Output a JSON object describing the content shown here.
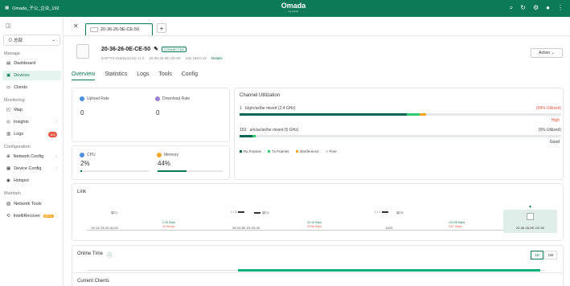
{
  "topbar": {
    "site_label": "Omada_子公_企业_192",
    "logo": "Omada",
    "logo_sub": "by tp-link",
    "icons": [
      "search-icon",
      "refresh-icon",
      "settings-icon",
      "user-icon",
      "more-icon"
    ],
    "color": "#0d7a57"
  },
  "sidebar": {
    "site_select": "总部",
    "sections": [
      {
        "title": "Manage",
        "items": [
          {
            "label": "Dashboard",
            "icon": "dashboard-icon"
          },
          {
            "label": "Devices",
            "icon": "devices-icon",
            "active": true
          },
          {
            "label": "Clients",
            "icon": "clients-icon"
          }
        ]
      },
      {
        "title": "Monitoring",
        "items": [
          {
            "label": "Map",
            "icon": "map-icon"
          },
          {
            "label": "Insights",
            "icon": "insights-icon",
            "arrow": true
          },
          {
            "label": "Logs",
            "icon": "logs-icon",
            "count": "404"
          }
        ]
      },
      {
        "title": "Configuration",
        "items": [
          {
            "label": "Network Config",
            "icon": "network-config-icon",
            "arrow": true
          },
          {
            "label": "Device Config",
            "icon": "device-config-icon",
            "arrow": true
          },
          {
            "label": "Hotspot",
            "icon": "hotspot-icon"
          }
        ]
      },
      {
        "title": "Maintain",
        "items": [
          {
            "label": "Network Tools",
            "icon": "network-tools-icon"
          },
          {
            "label": "IntelliRecover",
            "icon": "intellirecover-icon",
            "badge": "BETA"
          }
        ]
      }
    ]
  },
  "device_tab": {
    "label": "20-36-26-0E-CE-50"
  },
  "device": {
    "name": "20-36-26-0E-CE-50",
    "status": "CONNECTED",
    "model": "EAP772-Outdoor(US) v1.0",
    "mac": "20-36-26-0E-CE-50",
    "ip": "192.168.0.12",
    "details_link": "Details",
    "action_label": "Action"
  },
  "subtabs": [
    "Overview",
    "Statistics",
    "Logs",
    "Tools",
    "Config"
  ],
  "stats": {
    "upload_label": "Upload Rate",
    "upload_value": "0",
    "download_label": "Download Rate",
    "download_value": "0",
    "cpu_label": "CPU",
    "cpu_value": "2%",
    "cpu_fraction": 0.02,
    "memory_label": "Memory",
    "memory_value": "44%",
    "memory_fraction": 0.44
  },
  "channel": {
    "title": "Channel Utilization",
    "rows": [
      {
        "num": "1",
        "band": "b/g/n/ax/be mixed  (2.4 GHz)",
        "util": "(58% Utilized)",
        "level": "High",
        "level_color": "#e5533d",
        "rx": 0.52,
        "tx": 0.04,
        "interf": 0.02
      },
      {
        "num": "153",
        "band": "a/n/ac/ax/be mixed  (5 GHz)",
        "util": "(5% Utilized)",
        "level": "Good",
        "level_color": "#333333",
        "rx": 0.04,
        "tx": 0.01,
        "interf": 0.0
      }
    ],
    "legend": [
      {
        "label": "Rx Frames",
        "color": "#0e6655"
      },
      {
        "label": "Tx Frames",
        "color": "#2ecc71"
      },
      {
        "label": "Interference",
        "color": "#f5a623"
      },
      {
        "label": "Free",
        "color": "#d9dde2"
      }
    ]
  },
  "link": {
    "title": "Link",
    "nodes": [
      {
        "name": "00-14-78-00-00-00"
      },
      {
        "name": "98-03-8E-94-00-08"
      },
      {
        "name": "5428"
      },
      {
        "name": "20-36-26-0E-CE-50"
      }
    ],
    "speeds": [
      {
        "up": "2.26 Gbps",
        "down": "22.9k bps"
      },
      {
        "up": "20.44 Gbps",
        "down": "20.56 Gbps"
      },
      {
        "up": "120.08 Mbps",
        "down": "3.67 Gbps"
      }
    ],
    "port_labels": [
      "端口1",
      "1 = 5",
      "端口4",
      "1 = 1",
      "端口5"
    ]
  },
  "online_time": {
    "title": "Online Time",
    "ranges": [
      "1D",
      "1W"
    ],
    "ticks": [
      "01:28 am",
      "03:40 am",
      "05:51 am",
      "08:01 am",
      "10:12 am",
      "12:23 pm",
      "02:34 pm",
      "04:45 pm",
      "06:56 pm",
      "09:07 pm",
      "11:18 pm",
      "01:28 am"
    ],
    "online_start_fraction": 0.33,
    "online_end_fraction": 0.99
  },
  "current_clients": {
    "title": "Current Clients"
  }
}
